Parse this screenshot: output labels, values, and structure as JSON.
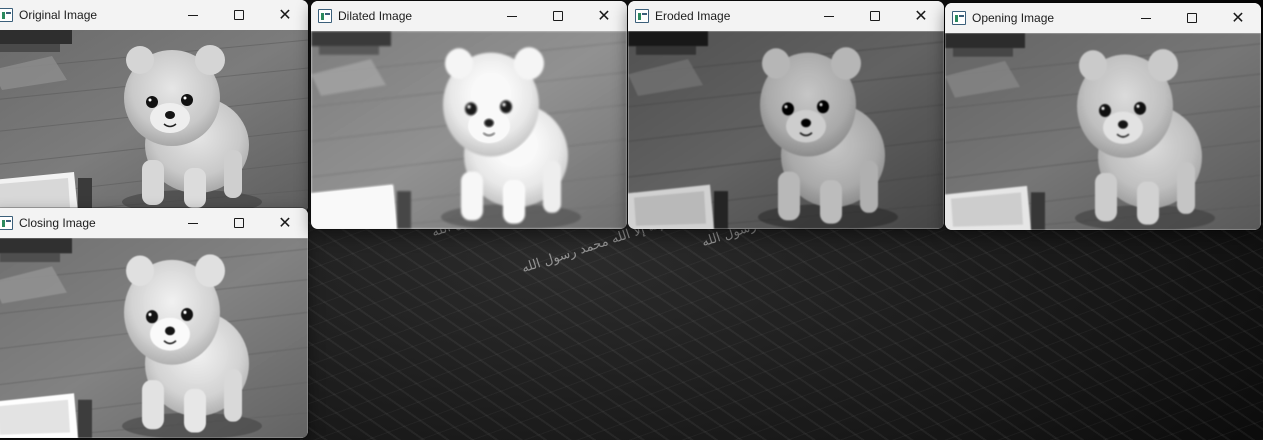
{
  "windows": [
    {
      "key": "original",
      "title": "Original Image",
      "filter": "none"
    },
    {
      "key": "dilated",
      "title": "Dilated Image",
      "filter": "dilate"
    },
    {
      "key": "eroded",
      "title": "Eroded Image",
      "filter": "erode"
    },
    {
      "key": "opening",
      "title": "Opening Image",
      "filter": "opening"
    },
    {
      "key": "closing",
      "title": "Closing Image",
      "filter": "closing"
    }
  ],
  "window_controls": {
    "minimize_icon": "minimize-icon",
    "maximize_icon": "maximize-icon",
    "close_icon": "close-icon"
  },
  "wallpaper": {
    "text": "لا إله إلا الله محمد رسول الله"
  },
  "colors": {
    "titlebar": "#f3f3f3",
    "desktop": "#1a1a1a"
  }
}
